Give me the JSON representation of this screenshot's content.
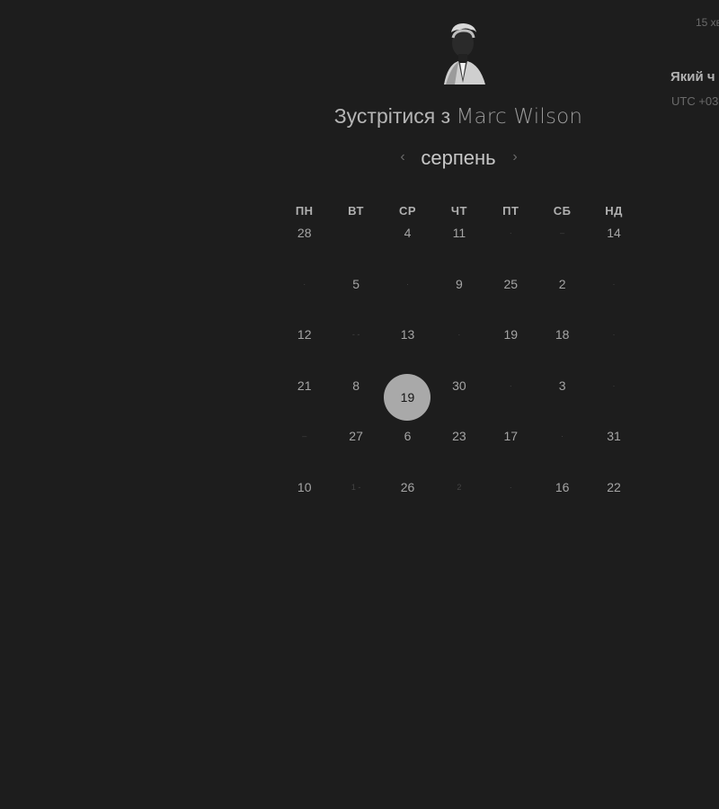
{
  "colors": {
    "background": "#1d1d1d",
    "selected_day": "#a9a9a9",
    "text_primary": "#b5b5b5",
    "text_muted": "#6a6a6a"
  },
  "header": {
    "avatar_icon": "person-avatar-icon",
    "title_prefix": "Зустрітися з",
    "title_name": "Marc Wilson"
  },
  "month_nav": {
    "prev_icon": "chevron-left-icon",
    "prev_symbol": "‹",
    "month": "серпень",
    "next_icon": "chevron-right-icon",
    "next_symbol": "›"
  },
  "calendar": {
    "weekdays": [
      "ПН",
      "ВТ",
      "СР",
      "ЧТ",
      "ПТ",
      "СБ",
      "НД"
    ],
    "weeks": [
      [
        {
          "text": "28",
          "faint": false
        },
        {
          "text": "",
          "faint": true
        },
        {
          "text": "4",
          "faint": false
        },
        {
          "text": "11",
          "faint": false
        },
        {
          "text": "·",
          "faint": true
        },
        {
          "text": "–",
          "faint": true
        },
        {
          "text": "14",
          "faint": false
        }
      ],
      [
        {
          "text": "·",
          "faint": true
        },
        {
          "text": "5",
          "faint": false
        },
        {
          "text": "·",
          "faint": true
        },
        {
          "text": "9",
          "faint": false
        },
        {
          "text": "25",
          "faint": false
        },
        {
          "text": "2",
          "faint": false
        },
        {
          "text": "·",
          "faint": true
        }
      ],
      [
        {
          "text": "12",
          "faint": false
        },
        {
          "text": "- -",
          "faint": true
        },
        {
          "text": "13",
          "faint": false
        },
        {
          "text": "·",
          "faint": true
        },
        {
          "text": "19",
          "faint": false
        },
        {
          "text": "18",
          "faint": false
        },
        {
          "text": "·",
          "faint": true
        }
      ],
      [
        {
          "text": "21",
          "faint": false
        },
        {
          "text": "8",
          "faint": false
        },
        {
          "text": "19",
          "faint": false,
          "selected": true
        },
        {
          "text": "30",
          "faint": false
        },
        {
          "text": "·",
          "faint": true
        },
        {
          "text": "3",
          "faint": false
        },
        {
          "text": "·",
          "faint": true
        }
      ],
      [
        {
          "text": "–",
          "faint": true
        },
        {
          "text": "27",
          "faint": false
        },
        {
          "text": "6",
          "faint": false
        },
        {
          "text": "23",
          "faint": false
        },
        {
          "text": "17",
          "faint": false
        },
        {
          "text": "·",
          "faint": true
        },
        {
          "text": "31",
          "faint": false
        }
      ],
      [
        {
          "text": "10",
          "faint": false
        },
        {
          "text": "1 -",
          "faint": true
        },
        {
          "text": "26",
          "faint": false
        },
        {
          "text": "2",
          "faint": true
        },
        {
          "text": "·",
          "faint": true
        },
        {
          "text": "16",
          "faint": false
        },
        {
          "text": "22",
          "faint": false
        }
      ]
    ]
  },
  "side_panel": {
    "duration": "15 хв",
    "question": "Який ч",
    "timezone": "UTC +03"
  }
}
